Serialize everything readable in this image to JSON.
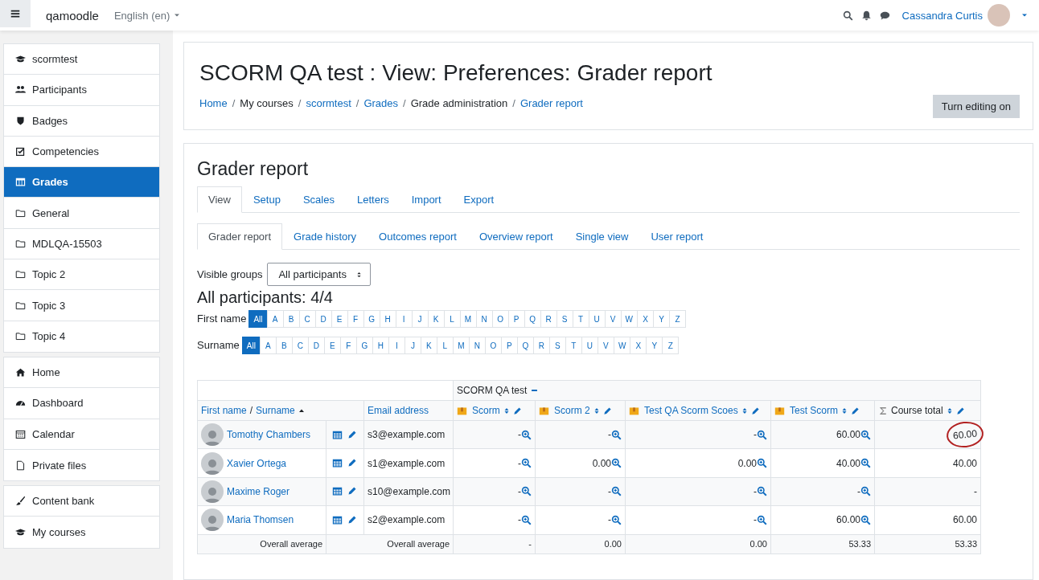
{
  "navbar": {
    "site_name": "qamoodle",
    "language": "English (en)",
    "user_name": "Cassandra Curtis"
  },
  "sidebar": {
    "groups": [
      [
        {
          "label": "scormtest",
          "selected": false
        },
        {
          "label": "Participants",
          "selected": false
        },
        {
          "label": "Badges",
          "selected": false
        },
        {
          "label": "Competencies",
          "selected": false
        },
        {
          "label": "Grades",
          "selected": true
        },
        {
          "label": "General",
          "selected": false
        },
        {
          "label": "MDLQA-15503",
          "selected": false
        },
        {
          "label": "Topic 2",
          "selected": false
        },
        {
          "label": "Topic 3",
          "selected": false
        },
        {
          "label": "Topic 4",
          "selected": false
        }
      ],
      [
        {
          "label": "Home",
          "selected": false
        },
        {
          "label": "Dashboard",
          "selected": false
        },
        {
          "label": "Calendar",
          "selected": false
        },
        {
          "label": "Private files",
          "selected": false
        }
      ],
      [
        {
          "label": "Content bank",
          "selected": false
        },
        {
          "label": "My courses",
          "selected": false
        }
      ]
    ]
  },
  "page_header": {
    "title": "SCORM QA test : View: Preferences: Grader report",
    "breadcrumb_separator": "/",
    "breadcrumb": [
      {
        "text": "Home",
        "link": true
      },
      {
        "text": "My courses",
        "link": false
      },
      {
        "text": "scormtest",
        "link": true
      },
      {
        "text": "Grades",
        "link": true
      },
      {
        "text": "Grade administration",
        "link": false
      },
      {
        "text": "Grader report",
        "link": true
      }
    ],
    "button": "Turn editing on"
  },
  "report": {
    "heading": "Grader report",
    "tabs": [
      {
        "label": "View",
        "selected": true
      },
      {
        "label": "Setup",
        "selected": false
      },
      {
        "label": "Scales",
        "selected": false
      },
      {
        "label": "Letters",
        "selected": false
      },
      {
        "label": "Import",
        "selected": false
      },
      {
        "label": "Export",
        "selected": false
      }
    ],
    "subtabs": [
      {
        "label": "Grader report",
        "selected": true
      },
      {
        "label": "Grade history",
        "selected": false
      },
      {
        "label": "Outcomes report",
        "selected": false
      },
      {
        "label": "Overview report",
        "selected": false
      },
      {
        "label": "Single view",
        "selected": false
      },
      {
        "label": "User report",
        "selected": false
      }
    ],
    "visible_groups": {
      "label": "Visible groups",
      "value": "All participants"
    },
    "participants_heading": "All participants: 4/4",
    "initials_bars": [
      {
        "label": "First name",
        "letters": [
          {
            "label": "All",
            "selected": true
          },
          {
            "label": "A",
            "selected": false
          },
          {
            "label": "B",
            "selected": false
          },
          {
            "label": "C",
            "selected": false
          },
          {
            "label": "D",
            "selected": false
          },
          {
            "label": "E",
            "selected": false
          },
          {
            "label": "F",
            "selected": false
          },
          {
            "label": "G",
            "selected": false
          },
          {
            "label": "H",
            "selected": false
          },
          {
            "label": "I",
            "selected": false
          },
          {
            "label": "J",
            "selected": false
          },
          {
            "label": "K",
            "selected": false
          },
          {
            "label": "L",
            "selected": false
          },
          {
            "label": "M",
            "selected": false
          },
          {
            "label": "N",
            "selected": false
          },
          {
            "label": "O",
            "selected": false
          },
          {
            "label": "P",
            "selected": false
          },
          {
            "label": "Q",
            "selected": false
          },
          {
            "label": "R",
            "selected": false
          },
          {
            "label": "S",
            "selected": false
          },
          {
            "label": "T",
            "selected": false
          },
          {
            "label": "U",
            "selected": false
          },
          {
            "label": "V",
            "selected": false
          },
          {
            "label": "W",
            "selected": false
          },
          {
            "label": "X",
            "selected": false
          },
          {
            "label": "Y",
            "selected": false
          },
          {
            "label": "Z",
            "selected": false
          }
        ]
      },
      {
        "label": "Surname",
        "letters": [
          {
            "label": "All",
            "selected": true
          },
          {
            "label": "A",
            "selected": false
          },
          {
            "label": "B",
            "selected": false
          },
          {
            "label": "C",
            "selected": false
          },
          {
            "label": "D",
            "selected": false
          },
          {
            "label": "E",
            "selected": false
          },
          {
            "label": "F",
            "selected": false
          },
          {
            "label": "G",
            "selected": false
          },
          {
            "label": "H",
            "selected": false
          },
          {
            "label": "I",
            "selected": false
          },
          {
            "label": "J",
            "selected": false
          },
          {
            "label": "K",
            "selected": false
          },
          {
            "label": "L",
            "selected": false
          },
          {
            "label": "M",
            "selected": false
          },
          {
            "label": "N",
            "selected": false
          },
          {
            "label": "O",
            "selected": false
          },
          {
            "label": "P",
            "selected": false
          },
          {
            "label": "Q",
            "selected": false
          },
          {
            "label": "R",
            "selected": false
          },
          {
            "label": "S",
            "selected": false
          },
          {
            "label": "T",
            "selected": false
          },
          {
            "label": "U",
            "selected": false
          },
          {
            "label": "V",
            "selected": false
          },
          {
            "label": "W",
            "selected": false
          },
          {
            "label": "X",
            "selected": false
          },
          {
            "label": "Y",
            "selected": false
          },
          {
            "label": "Z",
            "selected": false
          }
        ]
      }
    ],
    "table": {
      "category": "SCORM QA test",
      "first_name_header": "First name",
      "separator": "/",
      "surname_header": "Surname",
      "email_header": "Email address",
      "columns": [
        {
          "label": "Scorm",
          "kind": "activity"
        },
        {
          "label": "Scorm 2",
          "kind": "activity"
        },
        {
          "label": "Test QA Scorm Scoes",
          "kind": "activity"
        },
        {
          "label": "Test Scorm",
          "kind": "activity"
        },
        {
          "label": "Course total",
          "kind": "total"
        }
      ],
      "rows": [
        {
          "name": "Tomothy Chambers",
          "email": "s3@example.com",
          "grades": [
            {
              "text": "-",
              "circled": false
            },
            {
              "text": "-",
              "circled": false
            },
            {
              "text": "-",
              "circled": false
            },
            {
              "text": "60.00",
              "circled": false
            },
            {
              "text": "60.00",
              "circled": true
            }
          ]
        },
        {
          "name": "Xavier Ortega",
          "email": "s1@example.com",
          "grades": [
            {
              "text": "-",
              "circled": false
            },
            {
              "text": "0.00",
              "circled": false
            },
            {
              "text": "0.00",
              "circled": false
            },
            {
              "text": "40.00",
              "circled": false
            },
            {
              "text": "40.00",
              "circled": false
            }
          ]
        },
        {
          "name": "Maxime Roger",
          "email": "s10@example.com",
          "grades": [
            {
              "text": "-",
              "circled": false
            },
            {
              "text": "-",
              "circled": false
            },
            {
              "text": "-",
              "circled": false
            },
            {
              "text": "-",
              "circled": false
            },
            {
              "text": "-",
              "circled": false
            }
          ]
        },
        {
          "name": "Maria Thomsen",
          "email": "s2@example.com",
          "grades": [
            {
              "text": "-",
              "circled": false
            },
            {
              "text": "-",
              "circled": false
            },
            {
              "text": "-",
              "circled": false
            },
            {
              "text": "60.00",
              "circled": false
            },
            {
              "text": "60.00",
              "circled": false
            }
          ]
        }
      ],
      "footer": {
        "labels": [
          "Overall average",
          "Overall average"
        ],
        "values": [
          "-",
          "0.00",
          "0.00",
          "53.33",
          "53.33"
        ]
      }
    }
  }
}
